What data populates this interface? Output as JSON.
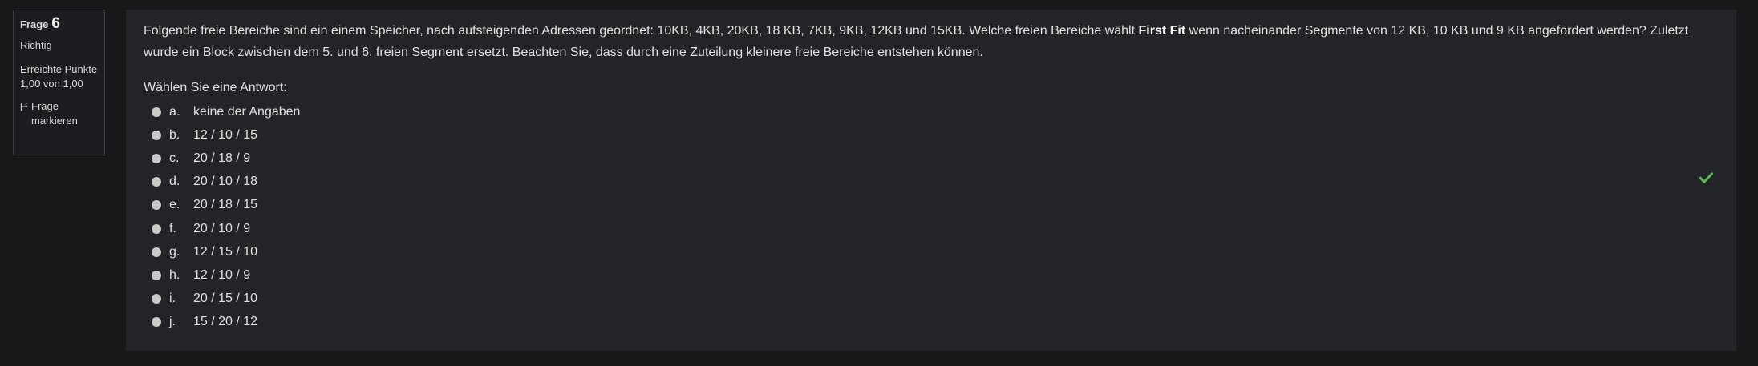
{
  "info": {
    "frage_label": "Frage",
    "frage_number": "6",
    "state": "Richtig",
    "grade": "Erreichte Punkte 1,00 von 1,00",
    "flag_label": "Frage markieren"
  },
  "question": {
    "text_part1": "Folgende freie Bereiche sind ein einem Speicher, nach aufsteigenden Adressen geordnet: 10KB, 4KB, 20KB, 18 KB, 7KB, 9KB, 12KB und 15KB. Welche freien Bereiche wählt ",
    "text_bold": "First Fit",
    "text_part2": " wenn nacheinander Segmente von 12 KB, 10 KB und 9 KB angefordert werden? Zuletzt wurde ein Block zwischen dem 5. und 6. freien Segment ersetzt. Beachten Sie, dass durch eine Zuteilung kleinere freie Bereiche entstehen können."
  },
  "prompt": "Wählen Sie eine Antwort:",
  "answers": [
    {
      "letter": "a.",
      "text": "keine der Angaben"
    },
    {
      "letter": "b.",
      "text": "12 / 10 / 15"
    },
    {
      "letter": "c.",
      "text": "20 / 18 / 9"
    },
    {
      "letter": "d.",
      "text": "20 / 10 / 18"
    },
    {
      "letter": "e.",
      "text": "20 / 18 / 15"
    },
    {
      "letter": "f.",
      "text": "20 / 10 / 9"
    },
    {
      "letter": "g.",
      "text": "12 / 15 / 10"
    },
    {
      "letter": "h.",
      "text": "12 / 10 / 9"
    },
    {
      "letter": "i.",
      "text": "20 / 15 / 10"
    },
    {
      "letter": "j.",
      "text": "15 / 20 / 12"
    }
  ],
  "colors": {
    "background": "#17181a",
    "panel": "#232427",
    "correct": "#5cb85c"
  },
  "icons": {
    "flag": "flag-icon",
    "correct": "check-icon"
  }
}
